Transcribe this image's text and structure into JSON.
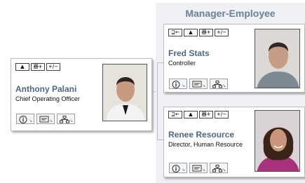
{
  "panel": {
    "title": "Manager-Employee"
  },
  "toolbar_labels": {
    "mgr": "⊒←",
    "up": "▲",
    "org": "器+",
    "expand": "+/−"
  },
  "cards": [
    {
      "name": "Anthony Palani",
      "title": "Chief Operating Officer"
    },
    {
      "name": "Fred Stats",
      "title": "Controller"
    },
    {
      "name": "Renee Resource",
      "title": "Director, Human Resource"
    }
  ],
  "colors": {
    "name": "#4b6789",
    "panel": "#eef0f3",
    "panel_title": "#6a7f9a"
  },
  "icons": [
    "info-icon",
    "email-icon",
    "org-chart-icon",
    "manager-icon",
    "up-arrow-icon",
    "hierarchy-icon",
    "expand-icon"
  ]
}
